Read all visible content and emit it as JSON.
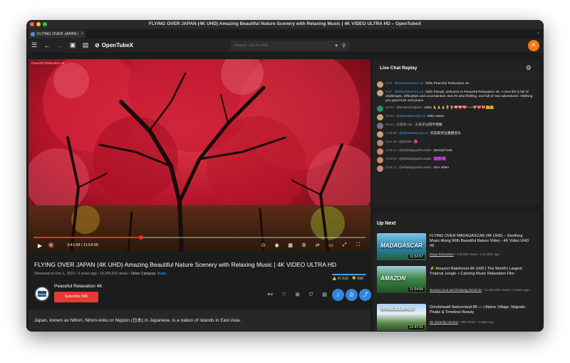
{
  "window": {
    "title": "FLYING OVER JAPAN (4K UHD) Amazing Beautiful Nature Scenery with Relaxing Music | 4K VIDEO ULTRA HD – OpenTubeX",
    "traffic_colors": [
      "#ff5f57",
      "#febc2e",
      "#28c840"
    ]
  },
  "tab": {
    "title": "FLYING OVER JAPAN (...",
    "close": "×",
    "overflow": "⌄"
  },
  "toolbar": {
    "menu_icon": "☰",
    "back_icon": "←",
    "forward_icon": "→",
    "pip_icon": "▣",
    "reader_icon": "▤",
    "brand": "OpenTubeX",
    "brand_logo": "⊘",
    "search_placeholder": "Search / Go to URL",
    "filter_icon": "▾",
    "search_icon": "⚲",
    "avatar": "A"
  },
  "player": {
    "watermark": "Peaceful Relaxation 4K",
    "progress": 0.325,
    "play_icon": "▶",
    "mute_icon": "🔇",
    "time": "3:41:58 / 11:54:56",
    "right_icons": [
      "⊙",
      "◉",
      "▦",
      "⚙",
      "⇄",
      "▭",
      "⤢",
      "⛶"
    ]
  },
  "video": {
    "title": "FLYING OVER JAPAN (4K UHD) Amazing Beautiful Nature Scenery with Relaxing Music | 4K VIDEO ULTRA HD",
    "streamed": "Streamed on Dec 1, 2022",
    "ago": "3 years ago",
    "views": "10,345,919 views",
    "category_label": "Video Category:",
    "category": "Music",
    "likes": "47,618",
    "dislikes": "898",
    "like_icon": "👍",
    "dislike_icon": "👎",
    "like_ratio": 0.98
  },
  "channel": {
    "name": "Peaceful Relaxation 4K",
    "logo_text": "Peaceful",
    "subscribe": "Subscribe 59K"
  },
  "actions": {
    "icons": [
      "≡+",
      "♡",
      "⊞",
      "⛉",
      "▤",
      "⤓",
      "⎙",
      "⤴"
    ]
  },
  "description": "Japan, known as Nihon, Nihon-koku or Nippon (日本) in Japanese, is a nation of islands in East Asia.",
  "chat": {
    "title": "Live Chat Replay",
    "filter_icon": "⚙",
    "messages": [
      {
        "time": "0:24",
        "author": "@SilverMoon15.12",
        "text": "hello Peaceful Relaxation 4K",
        "highlight": true,
        "color": "#c9a27b"
      },
      {
        "time": "0:47",
        "author": "@SilverMoon15.12",
        "text": "hello friends, welcome to Peaceful Relaxation 4K. A new life is full of challenges, difficulties and uncertainties. But it's also thrilling, and full of new adventures. Wishing you good luck and peace",
        "highlight": true,
        "color": "#c9a27b"
      },
      {
        "time": "40:03",
        "author": "@Kelvinmedjime",
        "text": "Hello 🙏🙏🙏🌷🌷💝💝💝+++💖💖💖🤗🤗",
        "highlight": false,
        "color": "#2e8b6a"
      },
      {
        "time": "40:52",
        "author": "@SilverMoon15.12",
        "text": "hello Nana",
        "highlight": true,
        "color": "#c9a27b"
      },
      {
        "time": "46:40",
        "author": "@游戏-ckc",
        "text": "小日子过得不错嘛",
        "highlight": false,
        "color": "#777777"
      },
      {
        "time": "1:03:59",
        "author": "@SilverMoon15.12",
        "text": "欢迎來到這裏聽音乐",
        "highlight": true,
        "color": "#c9a27b"
      },
      {
        "time": "2:51:39",
        "author": "@N10M",
        "text": "🌺",
        "highlight": false,
        "color": "#b08c75"
      },
      {
        "time": "2:55:44",
        "author": "@elliotnjapanfounder",
        "text": "tamsak host",
        "highlight": false,
        "color": "#d08a70"
      },
      {
        "time": "3:04:02",
        "author": "@elliotnjapanfounder",
        "text": "🟪🟪🟪",
        "highlight": false,
        "color": "#d08a70"
      },
      {
        "time": "3:34:14",
        "author": "@elliotnjapanfounder",
        "text": "nice video",
        "highlight": false,
        "color": "#d08a70"
      }
    ]
  },
  "upnext": {
    "title": "Up Next",
    "items": [
      {
        "title": "FLYING OVER MADAGASCAR (4K UHD) – Soothing Music Along With Beautiful Nature Video - 4K Video UHD #8",
        "channel": "Enjoy Relaxation",
        "meta": "• 128,000 views • 2 months ago",
        "duration": "11:54:57",
        "thumb_label": "MADAGASCAR",
        "thumb_color": "#2a7fa8",
        "ai": ""
      },
      {
        "title": "Amazon Rainforest 4K UHD | The World's Largest Tropical Jungle + Calming Music Relaxation Film",
        "channel": "Dreamy Soul and Relaxing World 4K",
        "meta": "• 11,000,000 views • 3 years ago",
        "duration": "11:54:56",
        "thumb_label": "AMAZON",
        "thumb_color": "#2f6e2f",
        "ai": "⚡"
      },
      {
        "title": "Grindelwald Switzerland 8K",
        "title_tail": "Alpine Village, Majestic Peaks & Timeless Beauty",
        "channel": "8K Serenity Horizon",
        "meta": "• 362 views • 4 days ago",
        "duration": "12:47:51",
        "thumb_label": "GRINDELWALD",
        "thumb_color": "#4e7fb5",
        "ai": ""
      }
    ]
  }
}
